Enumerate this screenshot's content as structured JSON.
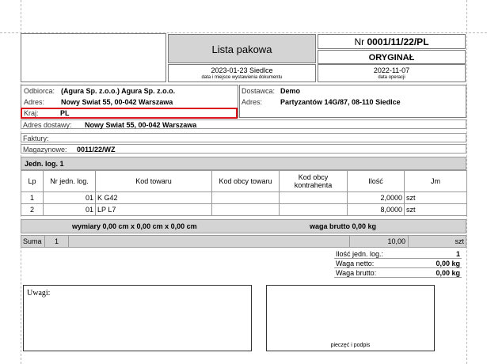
{
  "header": {
    "title": "Lista pakowa",
    "doc_number_prefix": "Nr ",
    "doc_number": "0001/11/22/PL",
    "copy_type": "ORYGINAŁ",
    "issue_date_place": "2023-01-23  Siedlce",
    "issue_caption": "data i miejsce wystawienia dokumentu",
    "operation_date": "2022-11-07",
    "operation_caption": "data operacji"
  },
  "recipient": {
    "label": "Odbiorca:",
    "name": "(Agura Sp. z.o.o.) Agura Sp. z.o.o.",
    "address_label": "Adres:",
    "address": "Nowy Swiat 55, 00-042 Warszawa",
    "country_label": "Kraj:",
    "country": "PL"
  },
  "supplier": {
    "label": "Dostawca:",
    "name": "Demo",
    "address_label": "Adres:",
    "address": "Partyzantów 14G/87, 08-110 Siedlce"
  },
  "delivery": {
    "label": "Adres dostawy:",
    "value": "Nowy Swiat 55, 00-042 Warszawa"
  },
  "invoices": {
    "label": "Faktury:",
    "value": ""
  },
  "warehouse": {
    "label": "Magazynowe:",
    "value": "0011/22/WZ"
  },
  "unit_title": "Jedn. log. 1",
  "table": {
    "headers": [
      "Lp",
      "Nr jedn. log.",
      "Kod towaru",
      "Kod obcy towaru",
      "Kod obcy kontrahenta",
      "Ilość",
      "Jm"
    ],
    "rows": [
      [
        "1",
        "01",
        "K G42",
        "",
        "",
        "2,0000",
        "szt"
      ],
      [
        "2",
        "01",
        "LP L7",
        "",
        "",
        "8,0000",
        "szt"
      ]
    ]
  },
  "dimensions": {
    "text": "wymiary 0,00 cm x 0,00 cm x 0,00 cm",
    "gross_weight": "waga brutto 0,00 kg"
  },
  "sum": {
    "label": "Suma",
    "count": "1",
    "quantity": "10,00",
    "unit": "szt"
  },
  "totals": {
    "units_label": "Ilość jedn. log.:",
    "units": "1",
    "net_label": "Waga netto:",
    "net": "0,00 kg",
    "gross_label": "Waga brutto:",
    "gross": "0,00 kg"
  },
  "notes_label": "Uwagi:",
  "signature_caption": "pieczęć i podpis",
  "colors": {
    "highlight": "#d9141a",
    "gray": "#d4d4d4"
  }
}
